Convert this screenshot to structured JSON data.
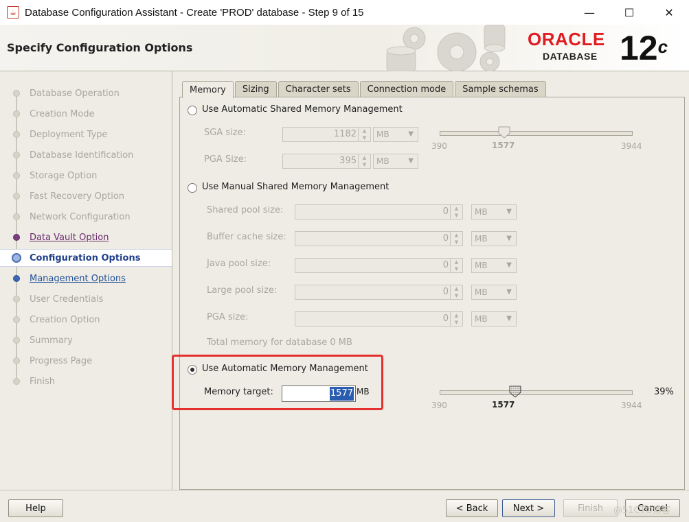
{
  "window": {
    "title": "Database Configuration Assistant - Create 'PROD' database - Step 9 of 15",
    "app_icon": "java-cup-icon",
    "minimize": "—",
    "maximize": "☐",
    "close": "✕"
  },
  "header": {
    "title": "Specify Configuration Options",
    "logo_word": "ORACLE",
    "logo_sub": "DATABASE",
    "version": "12",
    "version_suffix": "c",
    "colors": {
      "oracle_red": "#e11b22"
    }
  },
  "nav": {
    "items": [
      {
        "label": "Database Operation",
        "state": "done"
      },
      {
        "label": "Creation Mode",
        "state": "done"
      },
      {
        "label": "Deployment Type",
        "state": "done"
      },
      {
        "label": "Database Identification",
        "state": "done"
      },
      {
        "label": "Storage Option",
        "state": "done"
      },
      {
        "label": "Fast Recovery Option",
        "state": "done"
      },
      {
        "label": "Network Configuration",
        "state": "done"
      },
      {
        "label": "Data Vault Option",
        "state": "visited"
      },
      {
        "label": "Configuration Options",
        "state": "current"
      },
      {
        "label": "Management Options",
        "state": "next"
      },
      {
        "label": "User Credentials",
        "state": "pending"
      },
      {
        "label": "Creation Option",
        "state": "pending"
      },
      {
        "label": "Summary",
        "state": "pending"
      },
      {
        "label": "Progress Page",
        "state": "pending"
      },
      {
        "label": "Finish",
        "state": "pending"
      }
    ]
  },
  "tabs": [
    {
      "label": "Memory",
      "active": true
    },
    {
      "label": "Sizing",
      "active": false
    },
    {
      "label": "Character sets",
      "active": false
    },
    {
      "label": "Connection mode",
      "active": false
    },
    {
      "label": "Sample schemas",
      "active": false
    }
  ],
  "asmm": {
    "label": "Use Automatic Shared Memory Management",
    "selected": false,
    "sga_label": "SGA size:",
    "sga_value": "1182",
    "sga_unit": "MB",
    "pga_label": "PGA Size:",
    "pga_value": "395",
    "pga_unit": "MB",
    "slider_min": "390",
    "slider_value": "1577",
    "slider_max": "3944"
  },
  "manual": {
    "label": "Use Manual Shared Memory Management",
    "selected": false,
    "fields": [
      {
        "label": "Shared pool size:",
        "value": "0",
        "unit": "MB"
      },
      {
        "label": "Buffer cache size:",
        "value": "0",
        "unit": "MB"
      },
      {
        "label": "Java pool size:",
        "value": "0",
        "unit": "MB"
      },
      {
        "label": "Large pool size:",
        "value": "0",
        "unit": "MB"
      },
      {
        "label": "PGA size:",
        "value": "0",
        "unit": "MB"
      }
    ],
    "total": "Total memory for database 0 MB"
  },
  "amm": {
    "label": "Use Automatic Memory Management",
    "selected": true,
    "target_label": "Memory target:",
    "target_value": "1577",
    "target_unit": "MB",
    "slider_min": "390",
    "slider_value": "1577",
    "slider_max": "3944",
    "percent": "39%",
    "slider_fraction": 0.39
  },
  "buttons": {
    "help": "Help",
    "back": "< Back",
    "next": "Next >",
    "finish": "Finish",
    "cancel": "Cancel"
  },
  "watermark": "@51CTO博客"
}
